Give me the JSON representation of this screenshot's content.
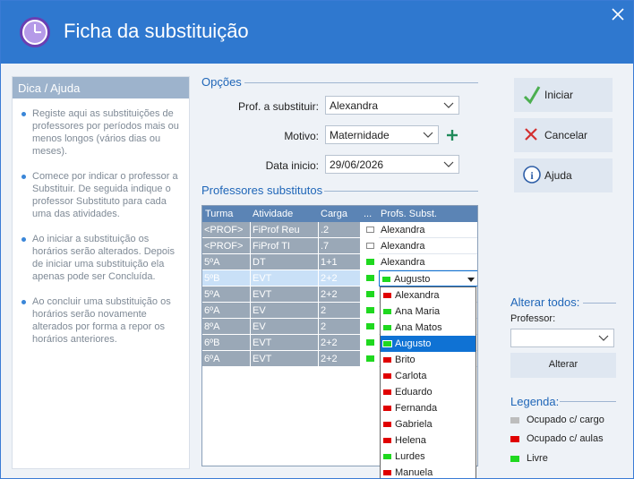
{
  "window": {
    "title": "Ficha da substituição"
  },
  "help": {
    "title": "Dica / Ajuda",
    "tips": [
      "Registe aqui as substituições de professores por períodos mais ou menos longos (vários dias ou meses).",
      "Comece por indicar o professor a Substituir. De seguida indique o professor Substituto para cada uma das atividades.",
      "Ao iniciar a substituição os horários serão alterados. Depois de iniciar uma substituição ela apenas pode ser Concluída.",
      "Ao concluir uma substituição os horários serão novamente alterados por forma a repor os horários anteriores."
    ]
  },
  "options": {
    "heading": "Opções",
    "prof_label": "Prof. a substituir:",
    "prof_value": "Alexandra",
    "motivo_label": "Motivo:",
    "motivo_value": "Maternidade",
    "date_label": "Data inicio:",
    "date_value": "29/06/2026"
  },
  "substitutes": {
    "heading": "Professores substitutos",
    "columns": [
      "Turma",
      "Atividade",
      "Carga",
      "...",
      "Profs. Subst."
    ],
    "rows": [
      {
        "turma": "<PROF>",
        "atividade": "FiProf Reu",
        "carga": ".2",
        "mark": "empty",
        "prof": "Alexandra"
      },
      {
        "turma": "<PROF>",
        "atividade": "FiProf TI",
        "carga": ".7",
        "mark": "empty",
        "prof": "Alexandra"
      },
      {
        "turma": "5ºA",
        "atividade": "DT",
        "carga": "1+1",
        "mark": "green",
        "prof": "Alexandra"
      },
      {
        "turma": "5ºB",
        "atividade": "EVT",
        "carga": "2+2",
        "mark": "green",
        "prof": "Augusto"
      },
      {
        "turma": "5ºA",
        "atividade": "EVT",
        "carga": "2+2",
        "mark": "green",
        "prof": ""
      },
      {
        "turma": "6ºA",
        "atividade": "EV",
        "carga": "2",
        "mark": "green",
        "prof": ""
      },
      {
        "turma": "8ºA",
        "atividade": "EV",
        "carga": "2",
        "mark": "green",
        "prof": ""
      },
      {
        "turma": "6ºB",
        "atividade": "EVT",
        "carga": "2+2",
        "mark": "green",
        "prof": ""
      },
      {
        "turma": "6ºA",
        "atividade": "EVT",
        "carga": "2+2",
        "mark": "green",
        "prof": ""
      }
    ]
  },
  "dropdown": {
    "items": [
      {
        "label": "Alexandra",
        "color": "red"
      },
      {
        "label": "Ana Maria",
        "color": "green"
      },
      {
        "label": "Ana Matos",
        "color": "green"
      },
      {
        "label": "Augusto",
        "color": "green",
        "selected": true
      },
      {
        "label": "Brito",
        "color": "red"
      },
      {
        "label": "Carlota",
        "color": "red"
      },
      {
        "label": "Eduardo",
        "color": "red"
      },
      {
        "label": "Fernanda",
        "color": "red"
      },
      {
        "label": "Gabriela",
        "color": "red"
      },
      {
        "label": "Helena",
        "color": "red"
      },
      {
        "label": "Lurdes",
        "color": "green"
      },
      {
        "label": "Manuela",
        "color": "red"
      }
    ]
  },
  "buttons": {
    "iniciar": "Iniciar",
    "cancelar": "Cancelar",
    "ajuda": "Ajuda"
  },
  "alterar": {
    "heading": "Alterar todos:",
    "professor_label": "Professor:",
    "professor_value": "",
    "button": "Alterar"
  },
  "legend": {
    "heading": "Legenda:",
    "items": [
      {
        "label": "Ocupado c/ cargo",
        "color": "#bdbdbd"
      },
      {
        "label": "Ocupado c/ aulas",
        "color": "#e00000"
      },
      {
        "label": "Livre",
        "color": "#1fd81f"
      }
    ]
  },
  "colors": {
    "title_bar": "#2f78cf",
    "accent": "#1f66b8",
    "red": "#e00000",
    "green": "#1fd81f",
    "selection": "#0f72d4"
  }
}
